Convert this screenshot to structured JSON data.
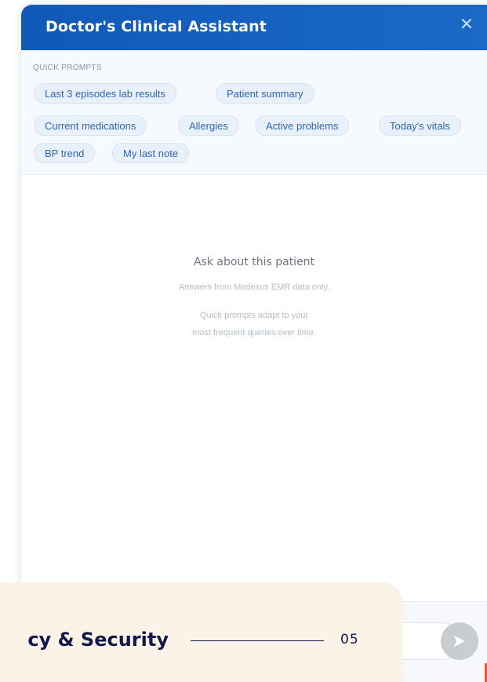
{
  "assistant": {
    "title": "Doctor's Clinical Assistant",
    "close_icon": "close-icon",
    "header_color": "#1563c0"
  },
  "quick_prompts": {
    "label": "QUICK PROMPTS",
    "chips": [
      "Last 3 episodes lab results",
      "Patient summary",
      "Current medications",
      "Allergies",
      "Active problems",
      "Today's vitals",
      "BP trend",
      "My last note"
    ]
  },
  "empty_state": {
    "title": "Ask about this patient",
    "subtitle": "Answers from Medexus EMR data only.",
    "hint_line1": "Quick prompts adapt to your",
    "hint_line2": "most frequent queries over time."
  },
  "composer": {
    "send_icon": "send-icon"
  },
  "overlay": {
    "text": "cy & Security",
    "number": "05",
    "background": "#fcf3e8",
    "text_color": "#11184a"
  }
}
